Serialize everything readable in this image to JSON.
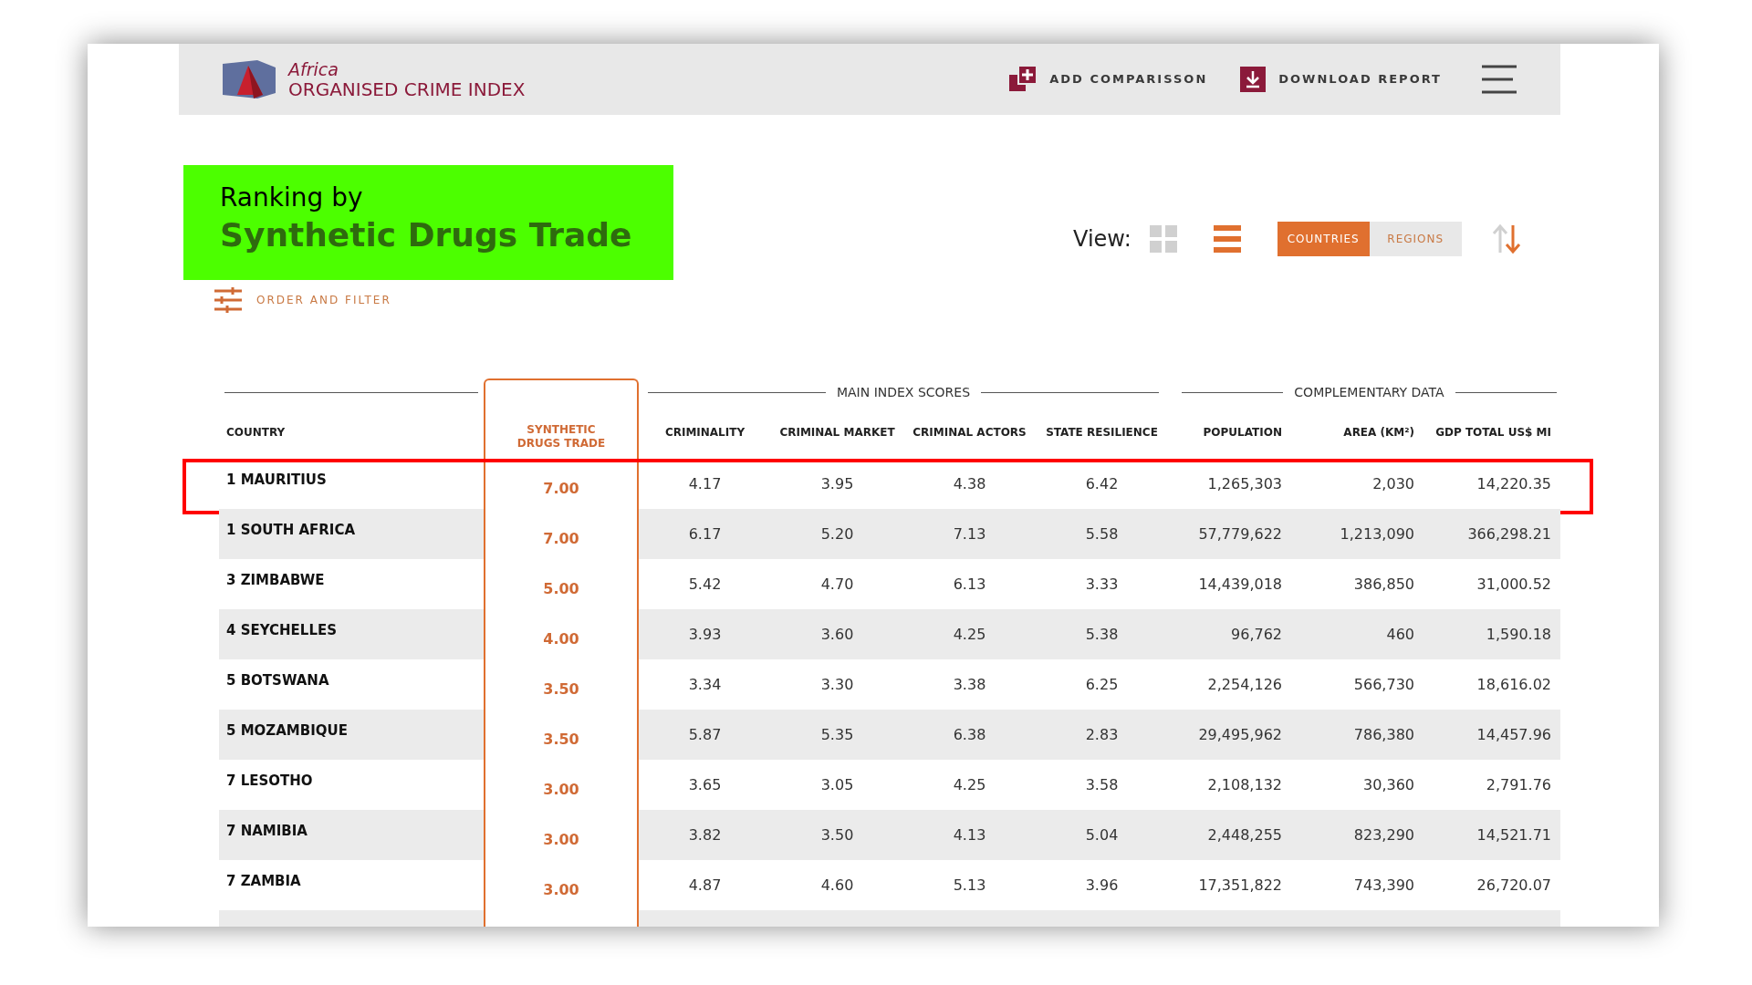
{
  "header": {
    "logo_top": "Africa",
    "logo_bottom": "ORGANISED CRIME INDEX",
    "actions": [
      {
        "kind": "compare",
        "label": "ADD COMPARISSON"
      },
      {
        "kind": "download",
        "label": "DOWNLOAD REPORT"
      }
    ]
  },
  "title": {
    "line1": "Ranking by",
    "line2": "Synthetic Drugs Trade"
  },
  "filter": "ORDER AND FILTER",
  "view": {
    "label": "View:",
    "modes": [
      {
        "kind": "grid",
        "selected": false
      },
      {
        "kind": "list",
        "selected": true
      }
    ],
    "toggles": [
      {
        "label": "COUNTRIES",
        "selected": true
      },
      {
        "label": "REGIONS",
        "selected": false
      }
    ]
  },
  "table": {
    "groups": [
      {
        "label": "MAIN INDEX SCORES"
      },
      {
        "label": "COMPLEMENTARY DATA"
      }
    ],
    "columns": [
      "COUNTRY",
      "SYNTHETIC DRUGS TRADE",
      "CRIMINALITY",
      "CRIMINAL MARKET",
      "CRIMINAL ACTORS",
      "STATE RESILIENCE",
      "POPULATION",
      "AREA (KM²)",
      "GDP TOTAL US$ MI"
    ],
    "rows": [
      {
        "highlighted": true,
        "cells": [
          "1 MAURITIUS",
          "7.00",
          "4.17",
          "3.95",
          "4.38",
          "6.42",
          "1,265,303",
          "2,030",
          "14,220.35"
        ]
      },
      {
        "highlighted": false,
        "cells": [
          "1 SOUTH AFRICA",
          "7.00",
          "6.17",
          "5.20",
          "7.13",
          "5.58",
          "57,779,622",
          "1,213,090",
          "366,298.21"
        ]
      },
      {
        "highlighted": false,
        "cells": [
          "3 ZIMBABWE",
          "5.00",
          "5.42",
          "4.70",
          "6.13",
          "3.33",
          "14,439,018",
          "386,850",
          "31,000.52"
        ]
      },
      {
        "highlighted": false,
        "cells": [
          "4 SEYCHELLES",
          "4.00",
          "3.93",
          "3.60",
          "4.25",
          "5.38",
          "96,762",
          "460",
          "1,590.18"
        ]
      },
      {
        "highlighted": false,
        "cells": [
          "5 BOTSWANA",
          "3.50",
          "3.34",
          "3.30",
          "3.38",
          "6.25",
          "2,254,126",
          "566,730",
          "18,616.02"
        ]
      },
      {
        "highlighted": false,
        "cells": [
          "5 MOZAMBIQUE",
          "3.50",
          "5.87",
          "5.35",
          "6.38",
          "2.83",
          "29,495,962",
          "786,380",
          "14,457.96"
        ]
      },
      {
        "highlighted": false,
        "cells": [
          "7 LESOTHO",
          "3.00",
          "3.65",
          "3.05",
          "4.25",
          "3.58",
          "2,108,132",
          "30,360",
          "2,791.76"
        ]
      },
      {
        "highlighted": false,
        "cells": [
          "7 NAMIBIA",
          "3.00",
          "3.82",
          "3.50",
          "4.13",
          "5.04",
          "2,448,255",
          "823,290",
          "14,521.71"
        ]
      },
      {
        "highlighted": false,
        "cells": [
          "7 ZAMBIA",
          "3.00",
          "4.87",
          "4.60",
          "5.13",
          "3.96",
          "17,351,822",
          "743,390",
          "26,720.07"
        ]
      }
    ]
  }
}
